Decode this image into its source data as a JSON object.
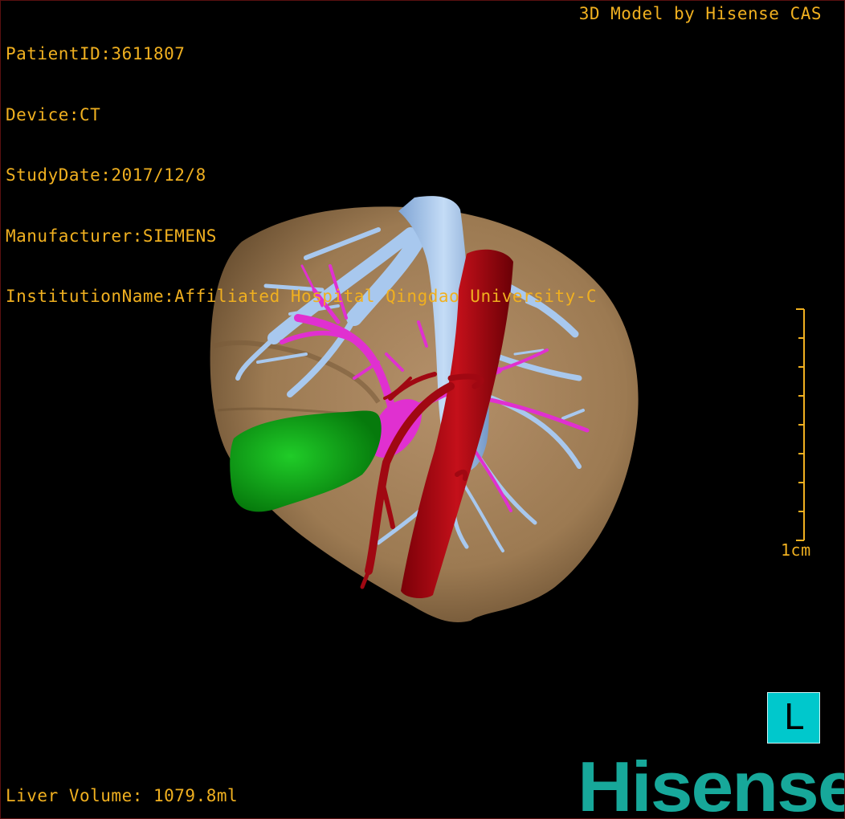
{
  "header": {
    "patient_id": "PatientID:3611807",
    "device": "Device:CT",
    "study_date": "StudyDate:2017/12/8",
    "manufacturer": "Manufacturer:SIEMENS",
    "institution": "InstitutionName:Affiliated Hospital Qingdao University-C"
  },
  "branding": {
    "model_credit": "3D Model by Hisense CAS",
    "logo_text": "Hisense",
    "logo_color": "#17a89a"
  },
  "footer": {
    "liver_volume": "Liver Volume: 1079.8ml"
  },
  "scale_bar": {
    "label": "1cm",
    "color": "#f0b020"
  },
  "orientation": {
    "label": "L",
    "color": "#00c8cc"
  },
  "model_colors": {
    "liver": "#a07d55",
    "artery": "#b00a14",
    "portal_vein": "#e030d0",
    "hepatic_vein": "#a8c8ee",
    "gallbladder": "#0ca818"
  }
}
